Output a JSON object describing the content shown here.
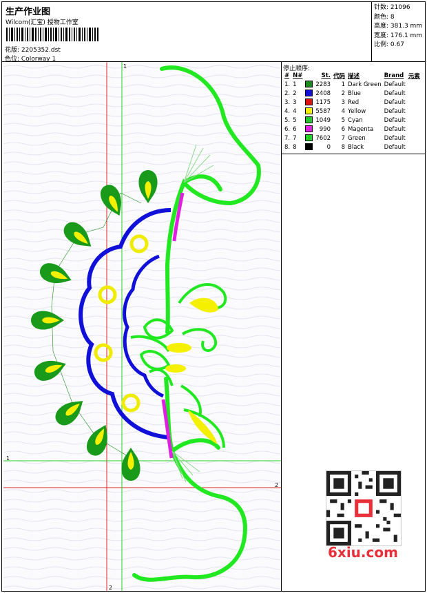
{
  "header": {
    "title": "生产作业图",
    "company": "Wilcom(汇宝) 授物工作室",
    "design_label": "花版:",
    "design_value": "2205352.dst",
    "colorway_label": "色位:",
    "colorway_value": "Colorway 1"
  },
  "stats": [
    {
      "label": "针数:",
      "value": "21096"
    },
    {
      "label": "颜色:",
      "value": "8"
    },
    {
      "label": "高度:",
      "value": "381.3 mm"
    },
    {
      "label": "宽度:",
      "value": "176.1 mm"
    },
    {
      "label": "比例:",
      "value": "0.67"
    }
  ],
  "stop_sequence": {
    "title": "停止顺序:",
    "headers": [
      "#",
      "N#",
      "St.",
      "代码",
      "描述",
      "Brand",
      "元素"
    ],
    "rows": [
      {
        "idx": "1.",
        "n": "1",
        "color": "#1a8a1a",
        "st": "2283",
        "code": "1",
        "desc": "Dark Green",
        "brand": "Default"
      },
      {
        "idx": "2.",
        "n": "2",
        "color": "#1010d8",
        "st": "2408",
        "code": "2",
        "desc": "Blue",
        "brand": "Default"
      },
      {
        "idx": "3.",
        "n": "3",
        "color": "#e01010",
        "st": "1175",
        "code": "3",
        "desc": "Red",
        "brand": "Default"
      },
      {
        "idx": "4.",
        "n": "4",
        "color": "#f5f000",
        "st": "5587",
        "code": "4",
        "desc": "Yellow",
        "brand": "Default"
      },
      {
        "idx": "5.",
        "n": "5",
        "color": "#22c82a",
        "st": "1049",
        "code": "5",
        "desc": "Cyan",
        "brand": "Default"
      },
      {
        "idx": "6.",
        "n": "6",
        "color": "#e020e0",
        "st": "990",
        "code": "6",
        "desc": "Magenta",
        "brand": "Default"
      },
      {
        "idx": "7.",
        "n": "7",
        "color": "#22d022",
        "st": "7602",
        "code": "7",
        "desc": "Green",
        "brand": "Default"
      },
      {
        "idx": "8.",
        "n": "8",
        "color": "#000000",
        "st": "0",
        "code": "8",
        "desc": "Black",
        "brand": "Default"
      }
    ]
  },
  "canvas": {
    "guide_labels": [
      "1",
      "1",
      "2",
      "2"
    ]
  },
  "watermark": "6xiu.com"
}
